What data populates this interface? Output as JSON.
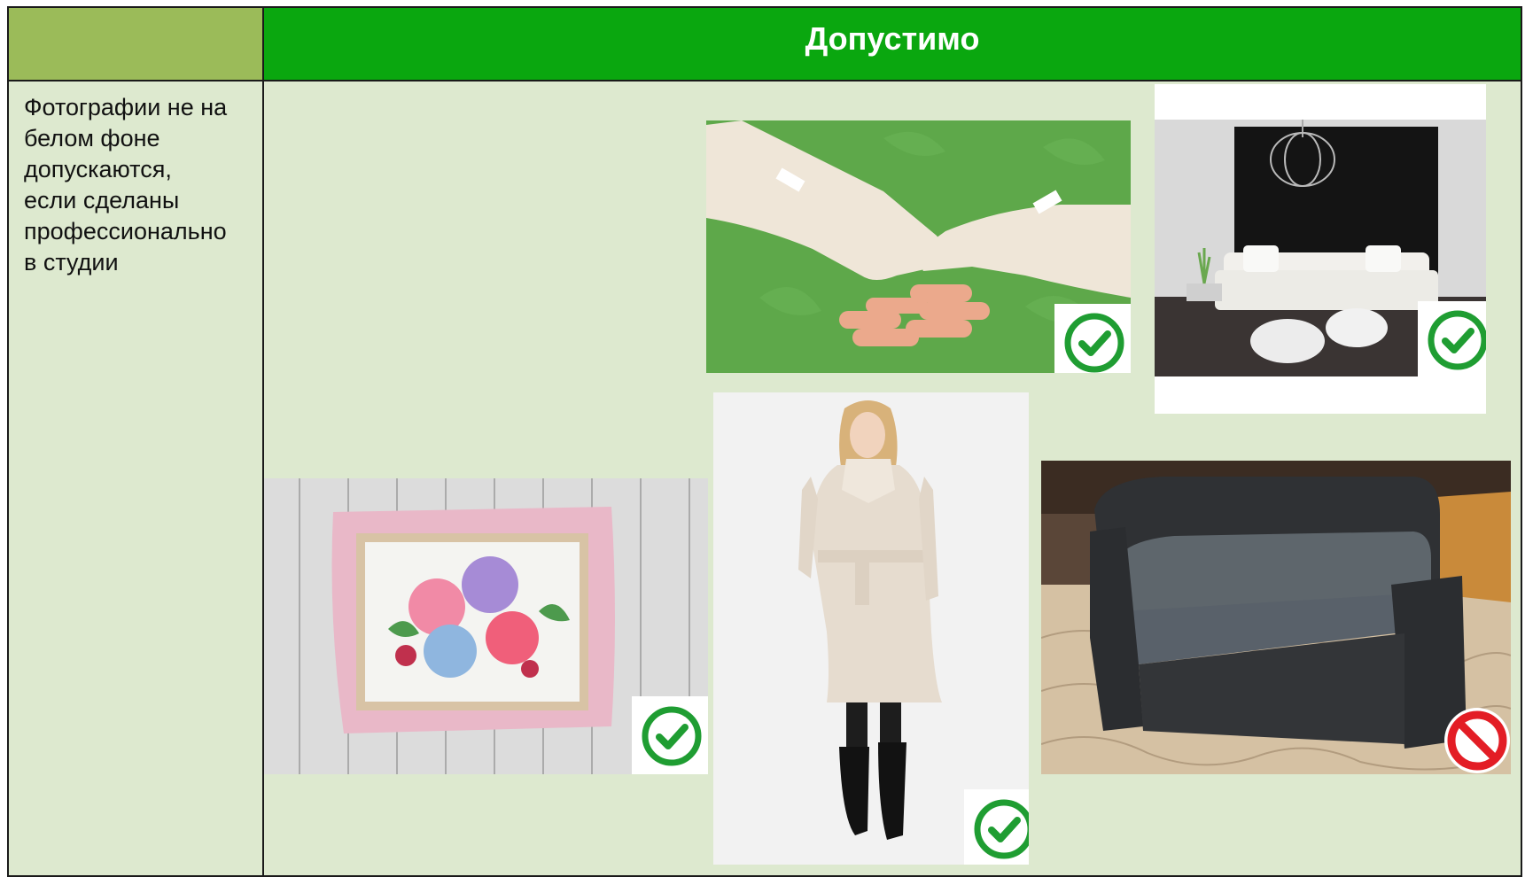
{
  "header": {
    "allowed_title": "Допустимо"
  },
  "rule": {
    "text": "Фотографии не на\nбелом фоне\nдопускаются,\nесли сделаны\nпрофессионально\nв студии"
  },
  "examples": [
    {
      "subject": "gloves",
      "verdict": "check-icon"
    },
    {
      "subject": "sofa-white",
      "verdict": "check-icon"
    },
    {
      "subject": "macarons-tray",
      "verdict": "check-icon"
    },
    {
      "subject": "coat",
      "verdict": "check-icon"
    },
    {
      "subject": "sofa-gray",
      "verdict": "prohibited-icon"
    }
  ],
  "colors": {
    "header_green": "#0aa70f",
    "header_olive": "#9bbb59",
    "body_bg": "#dde9cf",
    "check_green": "#1f9d32",
    "prohibit_red": "#e31d25"
  }
}
